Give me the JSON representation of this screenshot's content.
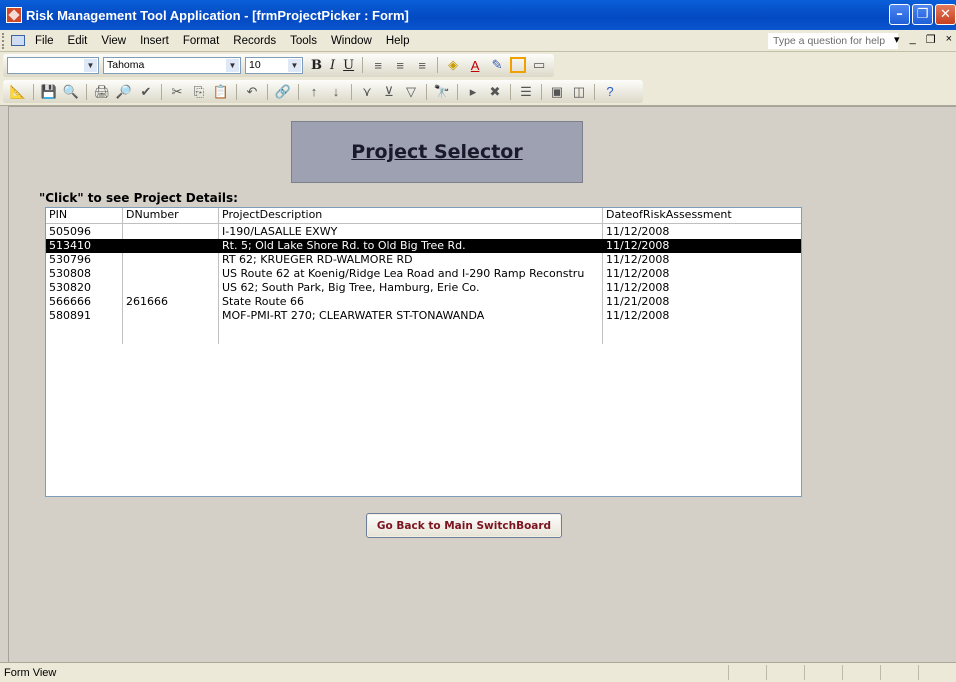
{
  "window": {
    "title": "Risk Management Tool Application - [frmProjectPicker : Form]",
    "minimize": "–",
    "restore": "❐",
    "close": "✕"
  },
  "menu": {
    "items": [
      "File",
      "Edit",
      "View",
      "Insert",
      "Format",
      "Records",
      "Tools",
      "Window",
      "Help"
    ],
    "help_placeholder": "Type a question for help"
  },
  "toolbar": {
    "object_combo": "",
    "font_combo": "Tahoma",
    "size_combo": "10",
    "bold": "B",
    "italic": "I",
    "underline": "U"
  },
  "form": {
    "header_title": "Project Selector",
    "instruction": "\"Click\" to see Project Details:",
    "columns": [
      "PIN",
      "DNumber",
      "ProjectDescription",
      "DateofRiskAssessment"
    ],
    "rows": [
      {
        "pin": "505096",
        "dnumber": "",
        "description": "I-190/LASALLE EXWY",
        "date": "11/12/2008"
      },
      {
        "pin": "513410",
        "dnumber": "",
        "description": "Rt. 5; Old Lake Shore Rd. to Old Big Tree Rd.",
        "date": "11/12/2008"
      },
      {
        "pin": "530796",
        "dnumber": "",
        "description": "RT 62; KRUEGER RD-WALMORE RD",
        "date": "11/12/2008"
      },
      {
        "pin": "530808",
        "dnumber": "",
        "description": "US Route 62 at Koenig/Ridge Lea Road and I-290 Ramp Reconstru",
        "date": "11/12/2008"
      },
      {
        "pin": "530820",
        "dnumber": "",
        "description": "US 62; South Park, Big Tree, Hamburg, Erie Co.",
        "date": "11/12/2008"
      },
      {
        "pin": "566666",
        "dnumber": "261666",
        "description": "State Route 66",
        "date": "11/21/2008"
      },
      {
        "pin": "580891",
        "dnumber": "",
        "description": "MOF-PMI-RT 270; CLEARWATER ST-TONAWANDA",
        "date": "11/12/2008"
      }
    ],
    "selected_row": 1,
    "main_button": "Go Back to Main SwitchBoard"
  },
  "status": {
    "mode": "Form View"
  }
}
